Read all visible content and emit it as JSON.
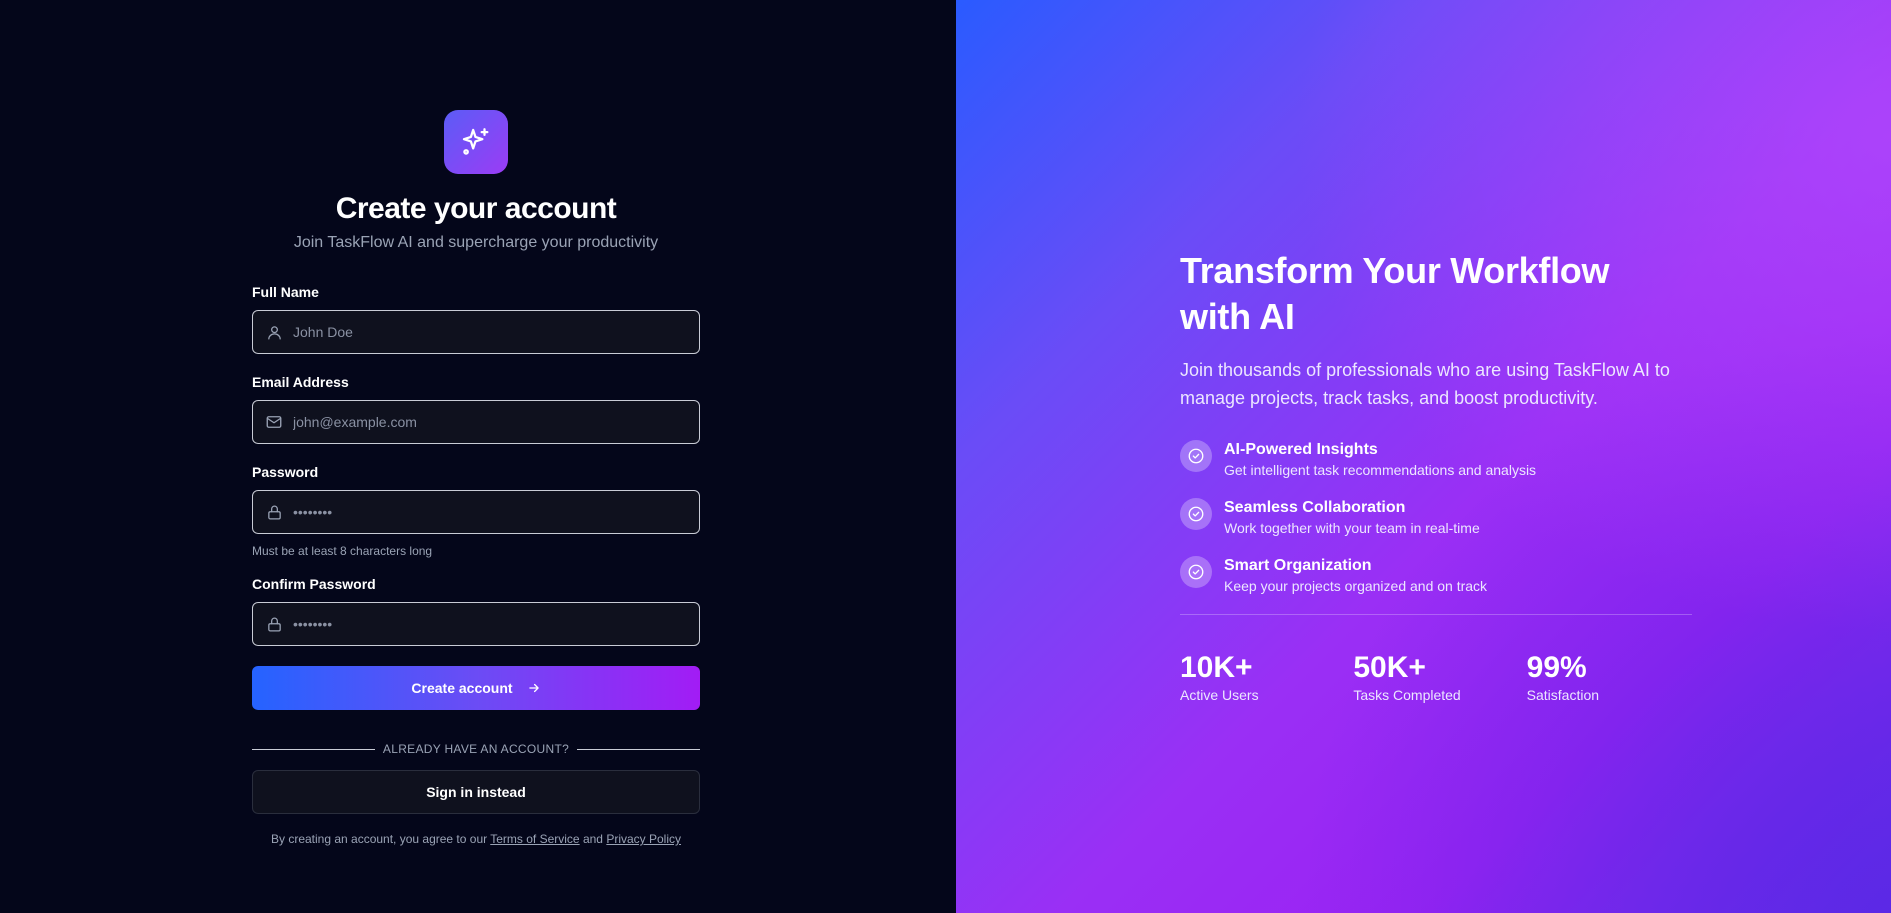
{
  "signup": {
    "title": "Create your account",
    "subtitle": "Join TaskFlow AI and supercharge your productivity",
    "full_name": {
      "label": "Full Name",
      "placeholder": "John Doe",
      "icon": "user-icon"
    },
    "email": {
      "label": "Email Address",
      "placeholder": "john@example.com",
      "icon": "mail-icon"
    },
    "password": {
      "label": "Password",
      "placeholder": "••••••••",
      "hint": "Must be at least 8 characters long",
      "icon": "lock-icon"
    },
    "confirm_password": {
      "label": "Confirm Password",
      "placeholder": "••••••••",
      "icon": "lock-icon"
    },
    "create_button": "Create account",
    "divider_text": "ALREADY HAVE AN ACCOUNT?",
    "signin_button": "Sign in instead",
    "terms_prefix": "By creating an account, you agree to our",
    "terms_link": "Terms of Service",
    "terms_and": "and",
    "privacy_link": "Privacy Policy"
  },
  "hero": {
    "title_line1": "Transform Your Workflow",
    "title_line2": "with AI",
    "lead": "Join thousands of professionals who are using TaskFlow AI to manage projects, track tasks, and boost productivity.",
    "features": [
      {
        "title": "AI-Powered Insights",
        "desc": "Get intelligent task recommendations and analysis"
      },
      {
        "title": "Seamless Collaboration",
        "desc": "Work together with your team in real-time"
      },
      {
        "title": "Smart Organization",
        "desc": "Keep your projects organized and on track"
      }
    ],
    "stats": [
      {
        "value": "10K+",
        "label": "Active Users"
      },
      {
        "value": "50K+",
        "label": "Tasks Completed"
      },
      {
        "value": "99%",
        "label": "Satisfaction"
      }
    ]
  },
  "colors": {
    "accent_start": "#2563ff",
    "accent_end": "#a21cf5",
    "background": "#04061a"
  }
}
